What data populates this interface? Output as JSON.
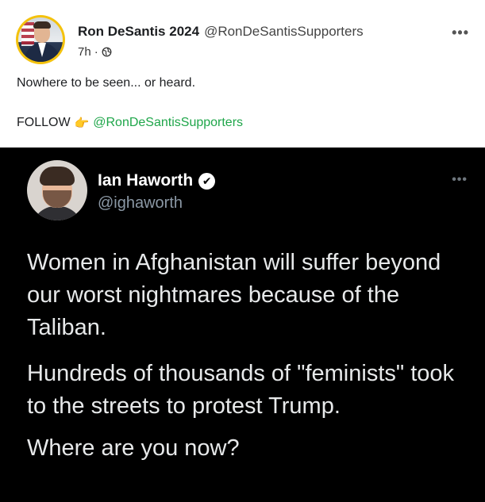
{
  "post": {
    "author_name": "Ron DeSantis 2024",
    "author_handle": "@RonDeSantisSupporters",
    "time": "7h",
    "separator": "·",
    "privacy_icon": "globe-icon",
    "more_label": "•••",
    "text": "Nowhere to be seen... or heard.",
    "follow_label": "FOLLOW",
    "follow_emoji": "👉",
    "follow_handle": "@RonDeSantisSupporters",
    "colors": {
      "avatar_ring": "#f4c20d",
      "handle_link": "#1fa64a"
    }
  },
  "tweet": {
    "author_name": "Ian Haworth",
    "author_handle": "@ighaworth",
    "verified_icon": "verified-badge-icon",
    "verified_glyph": "✔",
    "more_label": "•••",
    "paragraph1": "Women in Afghanistan will suffer beyond our worst nightmares because of the Taliban.",
    "paragraph2": "Hundreds of thousands of \"feminists\" took to the streets to protest Trump.",
    "paragraph3": "Where are you now?",
    "colors": {
      "background": "#000000",
      "text": "#e7e9ea",
      "secondary": "#8b98a5"
    }
  }
}
